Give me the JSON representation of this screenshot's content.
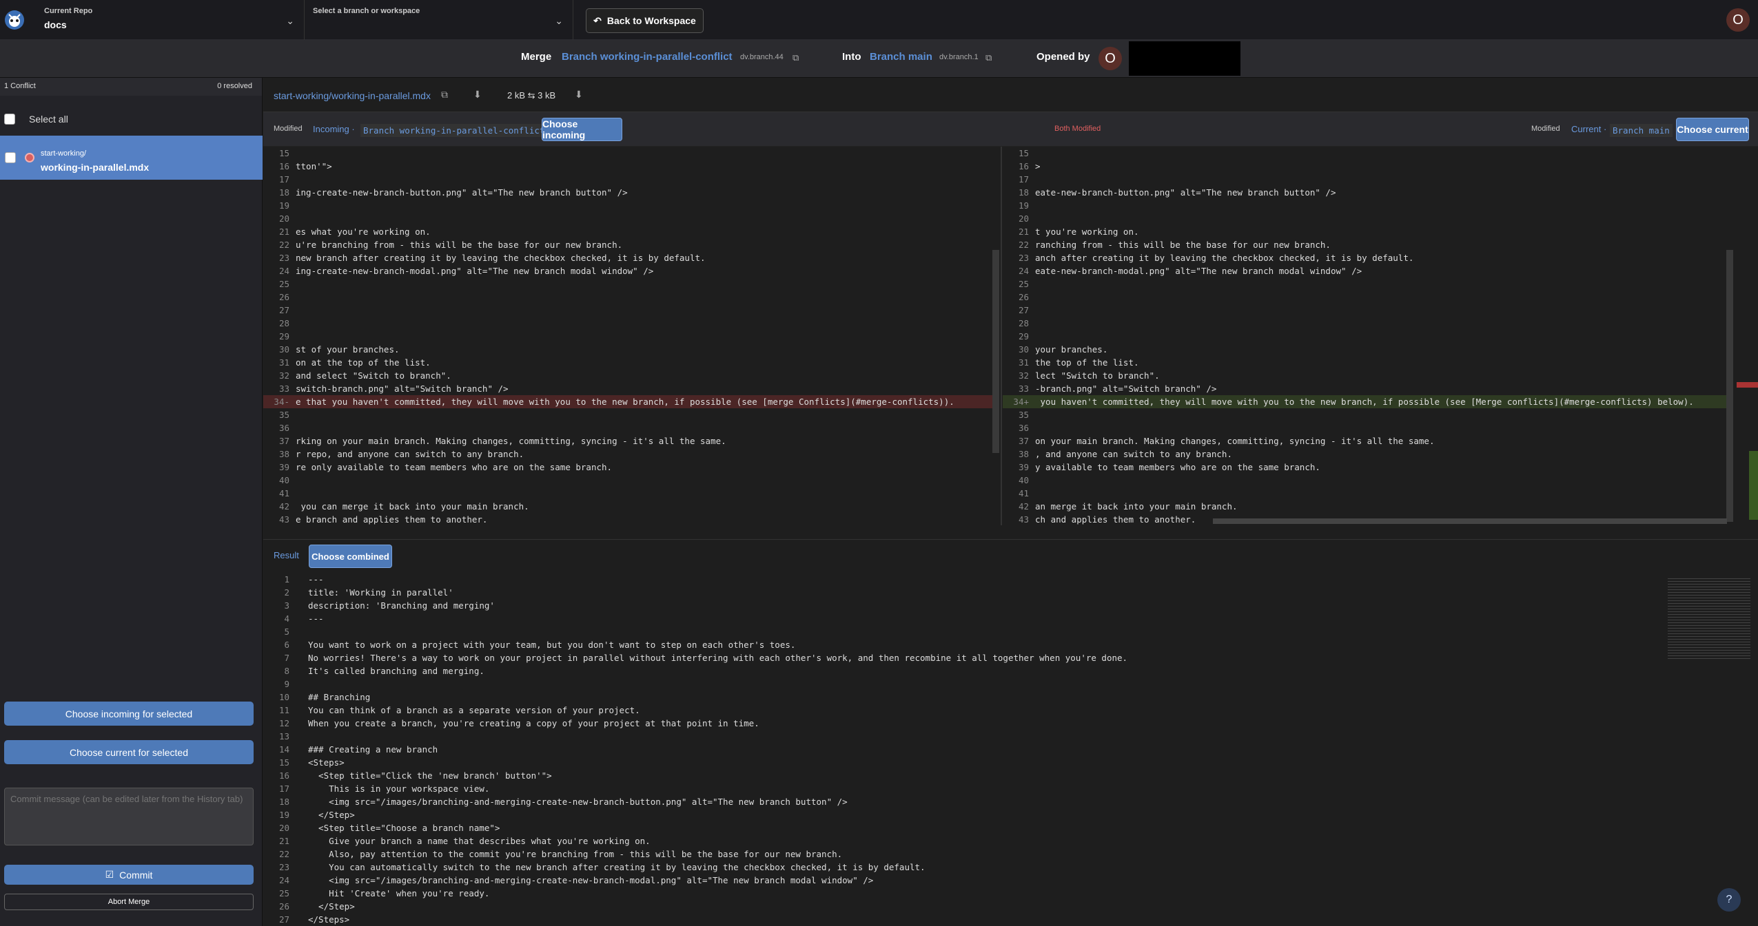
{
  "topbar": {
    "repo_label": "Current Repo",
    "repo_value": "docs",
    "branch_label": "Select a branch or workspace",
    "back_label": "Back to Workspace",
    "user_initial": "O"
  },
  "mergebar": {
    "merge_word": "Merge",
    "from_branch": "Branch working-in-parallel-conflict",
    "from_id": "dv.branch.44",
    "into_word": "Into",
    "into_branch": "Branch main",
    "into_id": "dv.branch.1",
    "opened_by": "Opened by",
    "opener_initial": "O"
  },
  "sidebar": {
    "conflicts": "1 Conflict",
    "resolved": "0 resolved",
    "select_all": "Select all",
    "file_dir": "start-working/",
    "file_name": "working-in-parallel.mdx",
    "choose_incoming_sel": "Choose incoming for selected",
    "choose_current_sel": "Choose current for selected",
    "commit_placeholder": "Commit message (can be edited later from the History tab)",
    "commit": "Commit",
    "abort": "Abort Merge"
  },
  "file": {
    "path": "start-working/working-in-parallel.mdx",
    "size": "2 kB ⇆ 3 kB"
  },
  "panes": {
    "left_modified": "Modified",
    "left_incoming": "Incoming ·",
    "left_branch": "Branch working-in-parallel-conflict",
    "choose_incoming": "Choose incoming",
    "both_modified": "Both Modified",
    "right_modified": "Modified",
    "right_current": "Current ·",
    "right_branch": "Branch main",
    "choose_current": "Choose current"
  },
  "left_lines": [
    {
      "n": "15",
      "t": ""
    },
    {
      "n": "16",
      "t": "tton'\">"
    },
    {
      "n": "17",
      "t": ""
    },
    {
      "n": "18",
      "t": "ing-create-new-branch-button.png\" alt=\"The new branch button\" />"
    },
    {
      "n": "19",
      "t": ""
    },
    {
      "n": "20",
      "t": ""
    },
    {
      "n": "21",
      "t": "es what you're working on."
    },
    {
      "n": "22",
      "t": "u're branching from - this will be the base for our new branch."
    },
    {
      "n": "23",
      "t": "new branch after creating it by leaving the checkbox checked, it is by default."
    },
    {
      "n": "24",
      "t": "ing-create-new-branch-modal.png\" alt=\"The new branch modal window\" />"
    },
    {
      "n": "25",
      "t": ""
    },
    {
      "n": "26",
      "t": ""
    },
    {
      "n": "27",
      "t": ""
    },
    {
      "n": "28",
      "t": ""
    },
    {
      "n": "29",
      "t": ""
    },
    {
      "n": "30",
      "t": "st of your branches."
    },
    {
      "n": "31",
      "t": "on at the top of the list."
    },
    {
      "n": "32",
      "t": "and select \"Switch to branch\"."
    },
    {
      "n": "33",
      "t": "switch-branch.png\" alt=\"Switch branch\" />"
    },
    {
      "n": "34-",
      "t": "e that you haven't committed, they will move with you to the new branch, if possible (see [merge Conflicts](#merge-conflicts)).",
      "hl": "red"
    },
    {
      "n": "35",
      "t": ""
    },
    {
      "n": "36",
      "t": ""
    },
    {
      "n": "37",
      "t": "rking on your main branch. Making changes, committing, syncing - it's all the same."
    },
    {
      "n": "38",
      "t": "r repo, and anyone can switch to any branch."
    },
    {
      "n": "39",
      "t": "re only available to team members who are on the same branch."
    },
    {
      "n": "40",
      "t": ""
    },
    {
      "n": "41",
      "t": ""
    },
    {
      "n": "42",
      "t": " you can merge it back into your main branch."
    },
    {
      "n": "43",
      "t": "e branch and applies them to another."
    }
  ],
  "right_lines": [
    {
      "n": "15",
      "t": ""
    },
    {
      "n": "16",
      "t": ">"
    },
    {
      "n": "17",
      "t": ""
    },
    {
      "n": "18",
      "t": "eate-new-branch-button.png\" alt=\"The new branch button\" />"
    },
    {
      "n": "19",
      "t": ""
    },
    {
      "n": "20",
      "t": ""
    },
    {
      "n": "21",
      "t": "t you're working on."
    },
    {
      "n": "22",
      "t": "ranching from - this will be the base for our new branch."
    },
    {
      "n": "23",
      "t": "anch after creating it by leaving the checkbox checked, it is by default."
    },
    {
      "n": "24",
      "t": "eate-new-branch-modal.png\" alt=\"The new branch modal window\" />"
    },
    {
      "n": "25",
      "t": ""
    },
    {
      "n": "26",
      "t": ""
    },
    {
      "n": "27",
      "t": ""
    },
    {
      "n": "28",
      "t": ""
    },
    {
      "n": "29",
      "t": ""
    },
    {
      "n": "30",
      "t": "your branches."
    },
    {
      "n": "31",
      "t": "the top of the list."
    },
    {
      "n": "32",
      "t": "lect \"Switch to branch\"."
    },
    {
      "n": "33",
      "t": "-branch.png\" alt=\"Switch branch\" />"
    },
    {
      "n": "34+",
      "t": " you haven't committed, they will move with you to the new branch, if possible (see [Merge conflicts](#merge-conflicts) below).",
      "hl": "green"
    },
    {
      "n": "35",
      "t": ""
    },
    {
      "n": "36",
      "t": ""
    },
    {
      "n": "37",
      "t": "on your main branch. Making changes, committing, syncing - it's all the same."
    },
    {
      "n": "38",
      "t": ", and anyone can switch to any branch."
    },
    {
      "n": "39",
      "t": "y available to team members who are on the same branch."
    },
    {
      "n": "40",
      "t": ""
    },
    {
      "n": "41",
      "t": ""
    },
    {
      "n": "42",
      "t": "an merge it back into your main branch."
    },
    {
      "n": "43",
      "t": "ch and applies them to another."
    }
  ],
  "result": {
    "tab_result": "Result",
    "tab_combined": "Choose combined"
  },
  "result_lines": [
    {
      "n": "1",
      "t": "---"
    },
    {
      "n": "2",
      "t": "title: 'Working in parallel'"
    },
    {
      "n": "3",
      "t": "description: 'Branching and merging'"
    },
    {
      "n": "4",
      "t": "---"
    },
    {
      "n": "5",
      "t": ""
    },
    {
      "n": "6",
      "t": "You want to work on a project with your team, but you don't want to step on each other's toes."
    },
    {
      "n": "7",
      "t": "No worries! There's a way to work on your project in parallel without interfering with each other's work, and then recombine it all together when you're done."
    },
    {
      "n": "8",
      "t": "It's called branching and merging."
    },
    {
      "n": "9",
      "t": ""
    },
    {
      "n": "10",
      "t": "## Branching"
    },
    {
      "n": "11",
      "t": "You can think of a branch as a separate version of your project."
    },
    {
      "n": "12",
      "t": "When you create a branch, you're creating a copy of your project at that point in time."
    },
    {
      "n": "13",
      "t": ""
    },
    {
      "n": "14",
      "t": "### Creating a new branch"
    },
    {
      "n": "15",
      "t": "<Steps>"
    },
    {
      "n": "16",
      "t": "  <Step title=\"Click the 'new branch' button'\">"
    },
    {
      "n": "17",
      "t": "    This is in your workspace view."
    },
    {
      "n": "18",
      "t": "    <img src=\"/images/branching-and-merging-create-new-branch-button.png\" alt=\"The new branch button\" />"
    },
    {
      "n": "19",
      "t": "  </Step>"
    },
    {
      "n": "20",
      "t": "  <Step title=\"Choose a branch name\">"
    },
    {
      "n": "21",
      "t": "    Give your branch a name that describes what you're working on."
    },
    {
      "n": "22",
      "t": "    Also, pay attention to the commit you're branching from - this will be the base for our new branch."
    },
    {
      "n": "23",
      "t": "    You can automatically switch to the new branch after creating it by leaving the checkbox checked, it is by default."
    },
    {
      "n": "24",
      "t": "    <img src=\"/images/branching-and-merging-create-new-branch-modal.png\" alt=\"The new branch modal window\" />"
    },
    {
      "n": "25",
      "t": "    Hit 'Create' when you're ready."
    },
    {
      "n": "26",
      "t": "  </Step>"
    },
    {
      "n": "27",
      "t": "</Steps>"
    }
  ],
  "help_icon": "?"
}
